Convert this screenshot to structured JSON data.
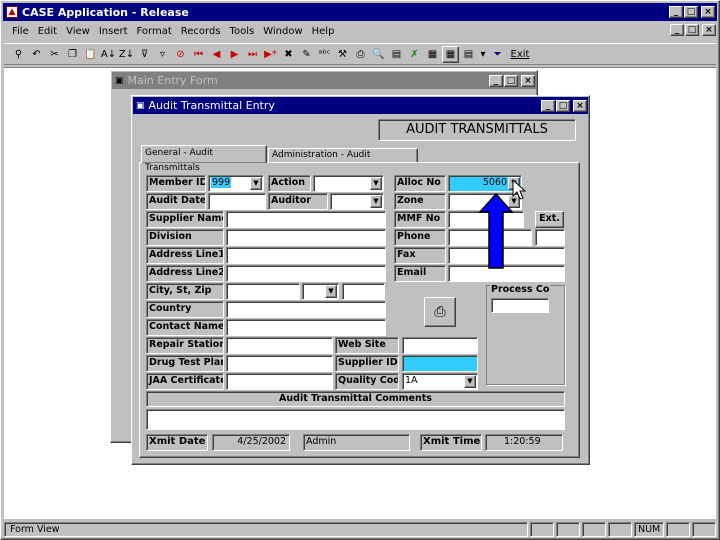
{
  "app": {
    "title": "CASE Application - Release"
  },
  "menu": [
    "File",
    "Edit",
    "View",
    "Insert",
    "Format",
    "Records",
    "Tools",
    "Window",
    "Help"
  ],
  "toolbar": {
    "exit_label": "Exit"
  },
  "main_form": {
    "title": "Main Entry Form"
  },
  "audit_form": {
    "title": "Audit Transmittal Entry",
    "heading": "AUDIT TRANSMITTALS",
    "tabs": [
      "General - Audit Transmittals",
      "Administration - Audit Transmittals"
    ],
    "labels": {
      "member_id": "Member ID",
      "action": "Action",
      "alloc_no": "Alloc No",
      "audit_date": "Audit Date",
      "auditor": "Auditor",
      "zone": "Zone",
      "supplier_name": "Supplier Name",
      "mmf_no": "MMF No",
      "ext": "Ext.",
      "division": "Division",
      "phone": "Phone",
      "address1": "Address Line1",
      "fax": "Fax",
      "address2": "Address Line2",
      "email": "Email",
      "city": "City, St, Zip",
      "process_co": "Process Co",
      "country": "Country",
      "contact": "Contact Name",
      "repair_station": "Repair Station",
      "web_site": "Web Site",
      "drug_test": "Drug Test Plan",
      "supplier_id": "Supplier ID",
      "jaa": "JAA Certificate",
      "quality_code": "Quality Code",
      "comments": "Audit Transmittal Comments",
      "xmit_date": "Xmit Date",
      "xmit_time": "Xmit Time"
    },
    "values": {
      "member_id": "999",
      "alloc_no": "5060",
      "quality_code": "1A",
      "xmit_date": "4/25/2002",
      "xmit_user": "Admin",
      "xmit_time": "1:20:59"
    }
  },
  "status": {
    "left": "Form View",
    "num": "NUM"
  },
  "colors": {
    "highlight": "#33ccff",
    "arrow": "#0000ff"
  }
}
